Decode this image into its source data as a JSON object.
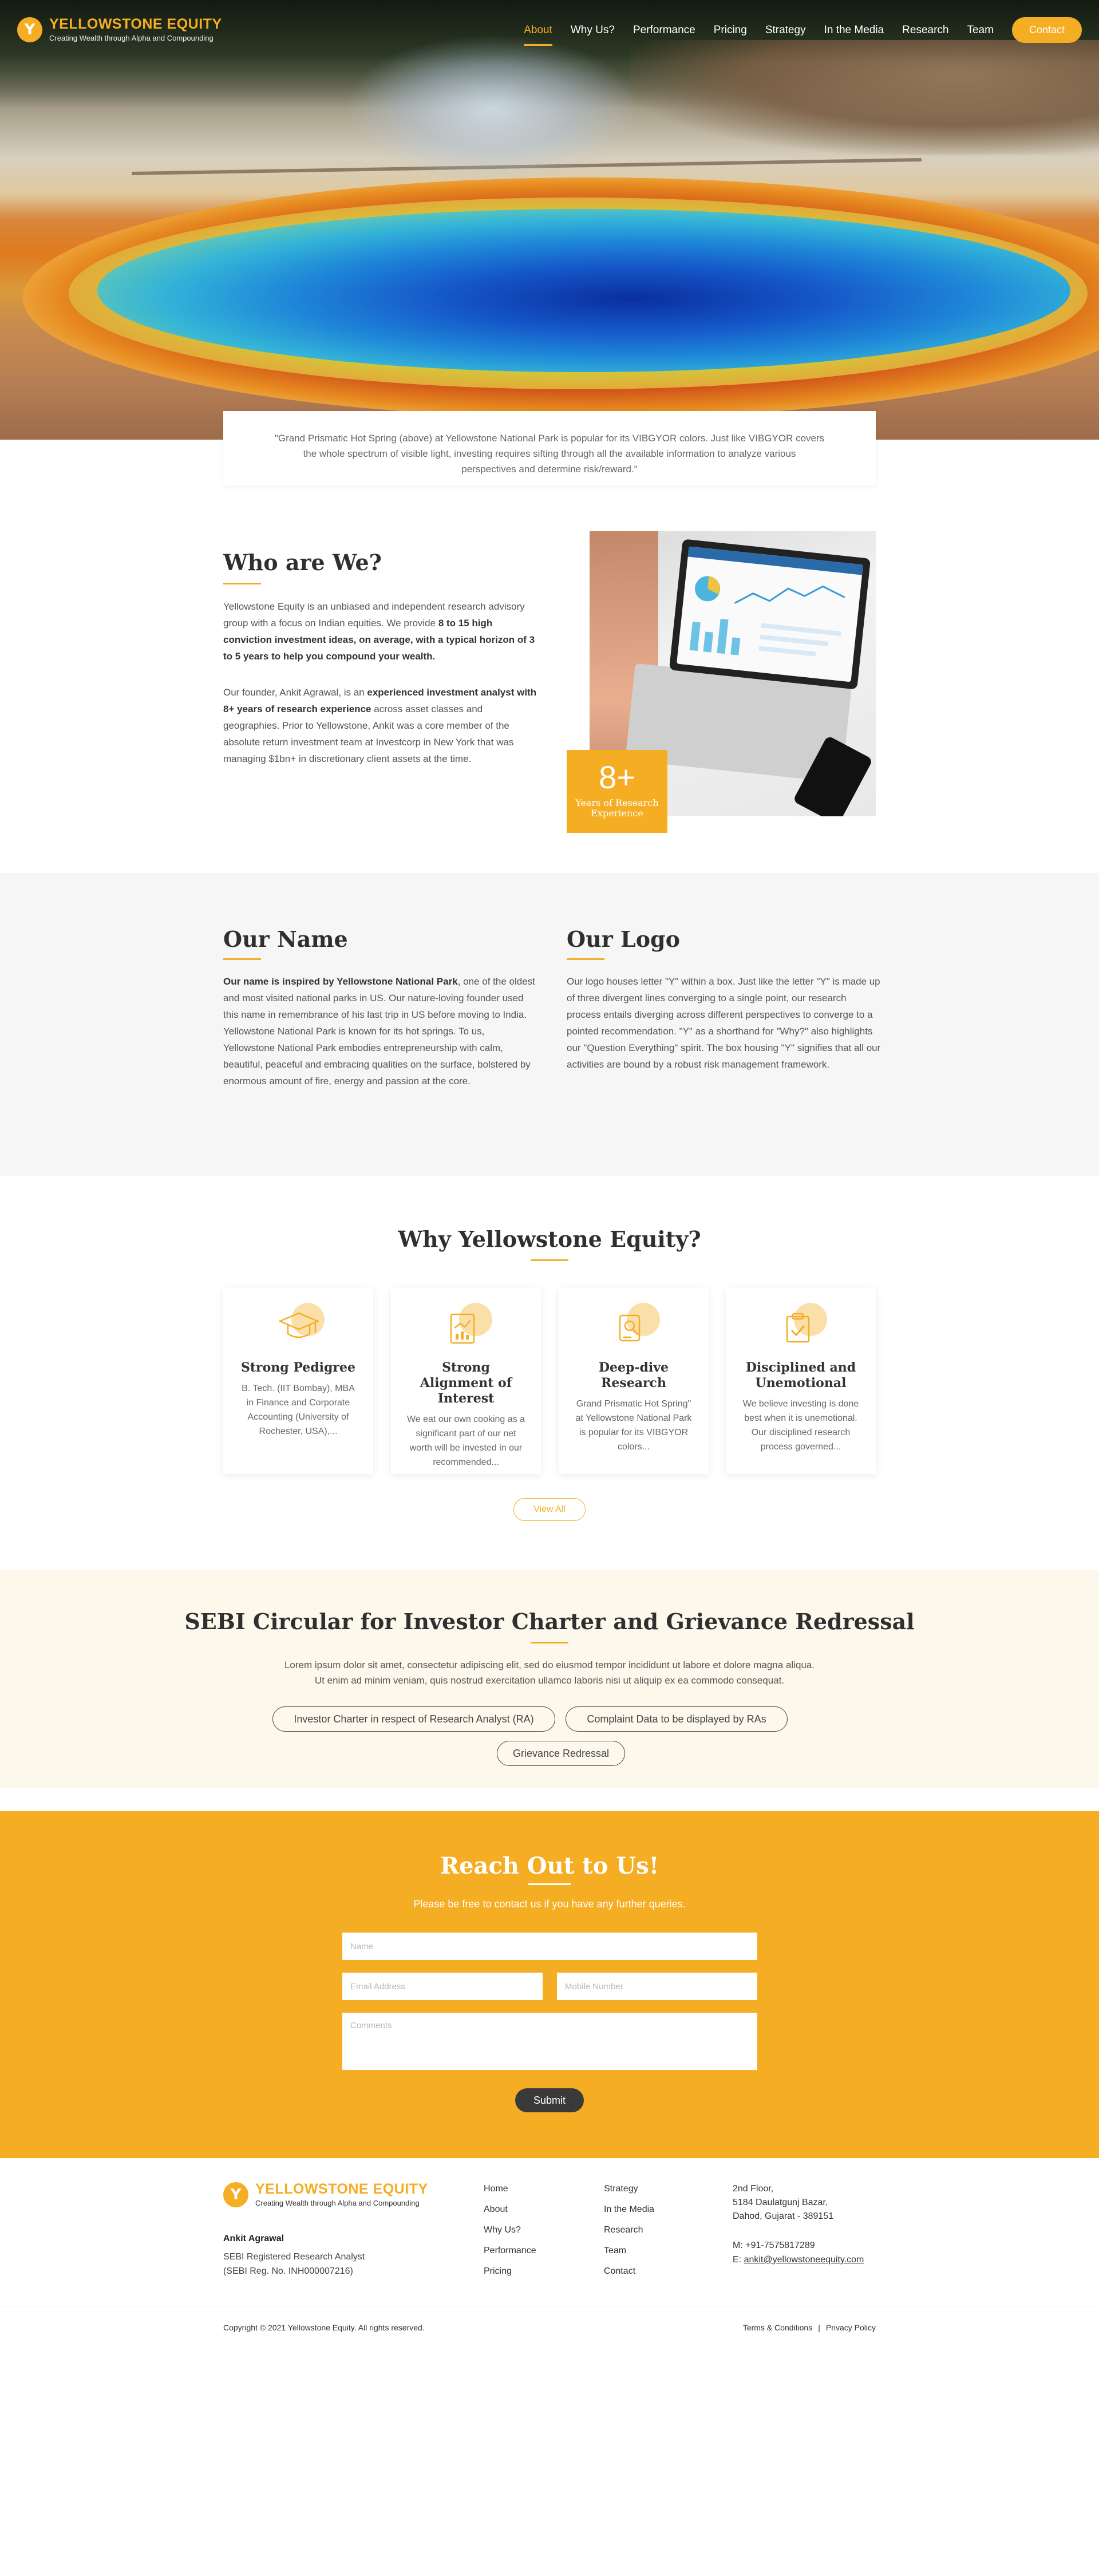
{
  "brand": {
    "name": "YELLOWSTONE EQUITY",
    "tagline": "Creating Wealth through Alpha and Compounding",
    "accent": "#f5ad24"
  },
  "nav": {
    "items": [
      "About",
      "Why Us?",
      "Performance",
      "Pricing",
      "Strategy",
      "In the Media",
      "Research",
      "Team"
    ],
    "active": "About",
    "contact": "Contact"
  },
  "hero": {
    "quote_line1": "\"Grand Prismatic Hot Spring (above) at Yellowstone National Park is popular for its VIBGYOR colors. Just like VIBGYOR covers",
    "quote_line2": "the whole spectrum of visible light, investing requires sifting through all the available information to analyze various",
    "quote_line3": "perspectives and determine risk/reward.\""
  },
  "who": {
    "title": "Who are We?",
    "p1_a": "Yellowstone Equity is an unbiased and independent research advisory group with a focus on Indian equities. We provide ",
    "p1_b": "8 to 15 high conviction investment ideas, on average, with a typical horizon of 3 to 5 years to help you compound your wealth.",
    "p2_a": "Our founder, Ankit Agrawal, is an ",
    "p2_b": "experienced investment analyst with 8+ years of research experience",
    "p2_c": " across asset classes and geographies. Prior to Yellowstone, Ankit was a core member of the absolute return investment team at Investcorp in New York that was managing $1bn+ in discretionary client assets at the time.",
    "badge_value": "8+",
    "badge_label": "Years of Research Experience"
  },
  "our_name": {
    "title": "Our Name",
    "lead": "Our name is inspired by Yellowstone National Park",
    "body": ", one of the oldest and most visited national parks in US. Our nature-loving founder used this name in remembrance of his last trip in US before moving to India. Yellowstone National Park is known for its hot springs. To us, Yellowstone National Park embodies entrepreneurship with calm, beautiful, peaceful and embracing qualities on the surface, bolstered by enormous amount of fire, energy and passion at the core."
  },
  "our_logo": {
    "title": "Our Logo",
    "body": "Our logo houses letter \"Y\" within a box. Just like the letter \"Y\" is made up of three divergent lines converging to a single point, our research process entails diverging across different perspectives to converge to a pointed recommendation. \"Y\" as a shorthand for \"Why?\" also highlights our \"Question Everything\" spirit. The box housing \"Y\" signifies that all our activities are bound by a robust risk management framework."
  },
  "why": {
    "title": "Why Yellowstone Equity?",
    "cards": [
      {
        "title": "Strong Pedigree",
        "text": "B. Tech. (IIT Bombay), MBA in Finance and Corporate Accounting (University of Rochester, USA),..."
      },
      {
        "title": "Strong Alignment of Interest",
        "text": "We eat our own cooking as a significant part of our net worth will be invested in our recommended..."
      },
      {
        "title": "Deep-dive Research",
        "text": "Grand Prismatic Hot Spring\" at Yellowstone National Park is popular for its VIBGYOR colors..."
      },
      {
        "title": "Disciplined and Unemotional",
        "text": "We believe investing is done best when it is unemotional. Our disciplined research process governed..."
      }
    ],
    "view_all": "View All"
  },
  "sebi": {
    "title": "SEBI Circular for Investor Charter and Grievance Redressal",
    "desc_line1": "Lorem ipsum dolor sit amet, consectetur adipiscing elit, sed do eiusmod tempor incididunt ut labore et dolore magna aliqua.",
    "desc_line2": "Ut enim ad minim veniam, quis nostrud exercitation ullamco laboris nisi ut aliquip ex ea commodo consequat.",
    "buttons": [
      "Investor Charter in respect of Research Analyst (RA)",
      "Complaint Data to be displayed by RAs",
      "Grievance Redressal"
    ]
  },
  "contact": {
    "title": "Reach Out to Us!",
    "subtitle": "Please be free to contact us if you have any further queries.",
    "name_placeholder": "Name",
    "email_placeholder": "Email Address",
    "mobile_placeholder": "Mobile Number",
    "comments_placeholder": "Comments",
    "submit": "Submit"
  },
  "footer": {
    "person": "Ankit Agrawal",
    "role": "SEBI Registered Research Analyst",
    "reg": "(SEBI Reg. No. INH000007216)",
    "col1": [
      "Home",
      "About",
      "Why Us?",
      "Performance",
      "Pricing"
    ],
    "col2": [
      "Strategy",
      "In the Media",
      "Research",
      "Team",
      "Contact"
    ],
    "address1": "2nd Floor,",
    "address2": "5184 Daulatgunj Bazar,",
    "address3": "Dahod, Gujarat - 389151",
    "phone": "M: +91-7575817289",
    "email_prefix": "E: ",
    "email": "ankit@yellowstoneequity.com",
    "copyright": "Copyright © 2021 Yellowstone Equity. All rights reserved.",
    "terms": "Terms & Conditions",
    "sep": "|",
    "privacy": "Privacy Policy"
  }
}
